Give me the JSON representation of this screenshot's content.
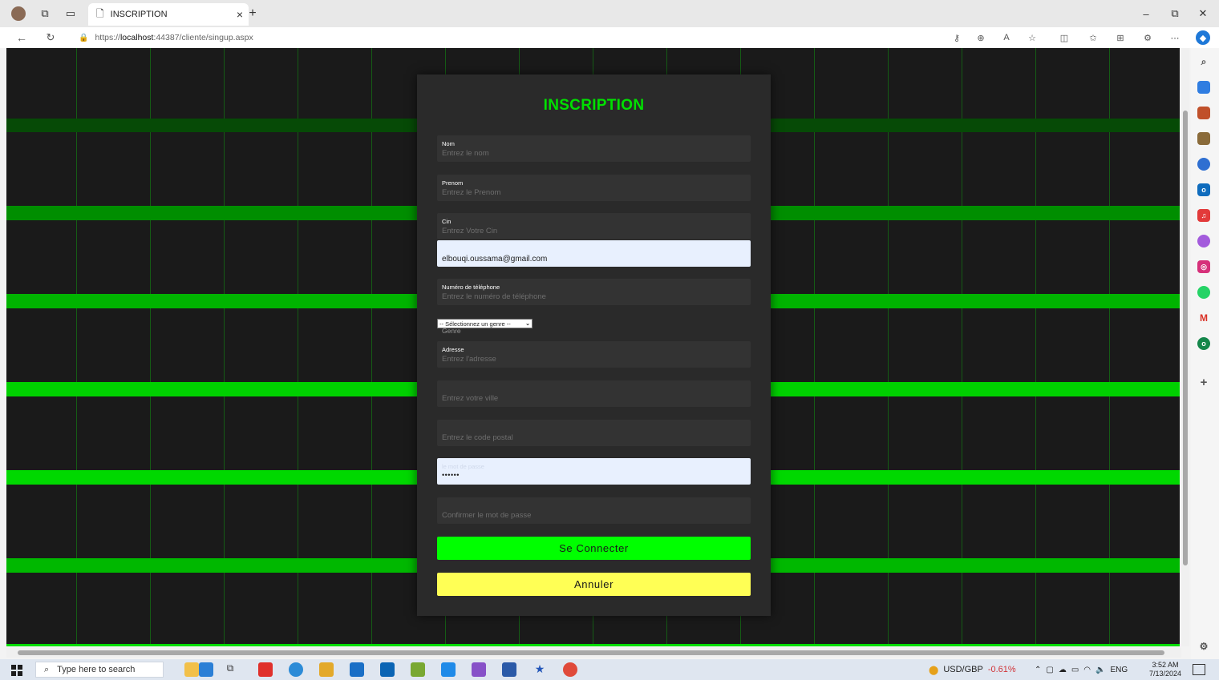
{
  "browser": {
    "tab_title": "INSCRIPTION",
    "url_prefix": "https://",
    "url_host": "localhost",
    "url_rest": ":44387/cliente/singup.aspx"
  },
  "form": {
    "title": "INSCRIPTION",
    "fields": [
      {
        "label": "Nom",
        "placeholder": "Entrez le nom"
      },
      {
        "label": "Prenom",
        "placeholder": "Entrez le Prenom"
      },
      {
        "label": "Cin",
        "placeholder": "Entrez Votre Cin"
      },
      {
        "label": "",
        "value": "elbouqi.oussama@gmail.com"
      },
      {
        "label": "Numéro de téléphone",
        "placeholder": "Entrez le numéro de téléphone"
      },
      {
        "label": "Adresse",
        "placeholder": "Entrez l'adresse"
      },
      {
        "label": "",
        "placeholder": "Entrez votre ville"
      },
      {
        "label": "",
        "placeholder": "Entrez le code postal"
      },
      {
        "label": "le mot de passe",
        "value": "••••••"
      },
      {
        "label": "",
        "placeholder": "Confirmer le mot de passe"
      }
    ],
    "genre_select": "-- Sélectionnez un genre --",
    "genre_label": "Genre",
    "connect_label": "Se Connecter",
    "cancel_label": "Annuler"
  },
  "taskbar": {
    "search_placeholder": "Type here to search",
    "ticker_pair": "USD/GBP",
    "ticker_change": "-0.61%",
    "language": "ENG",
    "time": "3:52 AM",
    "date": "7/13/2024"
  },
  "colors": {
    "accent_green": "#00e000",
    "connect_button": "#00ff00",
    "cancel_button": "#ffff55",
    "card_bg": "#2a2a2a"
  }
}
